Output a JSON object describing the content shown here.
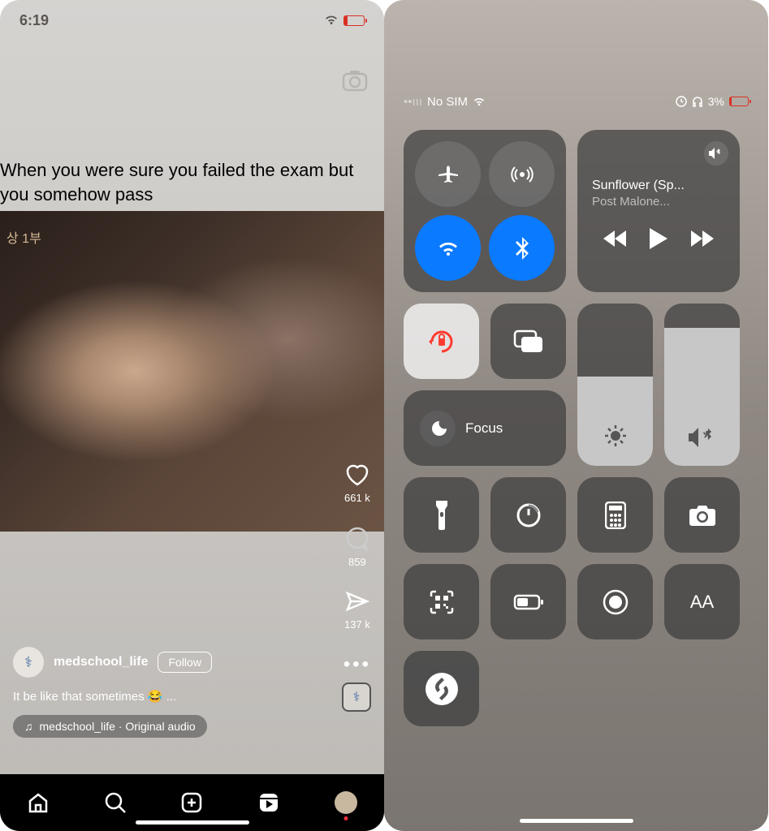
{
  "left": {
    "status": {
      "time": "6:19"
    },
    "meme_text": "When you were sure you failed the exam but you somehow pass",
    "video_label": "상 1부",
    "actions": {
      "likes": "661 k",
      "comments": "859",
      "shares": "137 k"
    },
    "username": "medschool_life",
    "follow": "Follow",
    "caption": "It be like that sometimes 😂  ...",
    "audio": "medschool_life · Original audio"
  },
  "right": {
    "status": {
      "carrier": "No SIM",
      "battery": "3%"
    },
    "music": {
      "title": "Sunflower (Sp...",
      "artist": "Post Malone..."
    },
    "focus": "Focus",
    "brightness_pct": 55,
    "volume_pct": 85,
    "text_size": "AA"
  }
}
